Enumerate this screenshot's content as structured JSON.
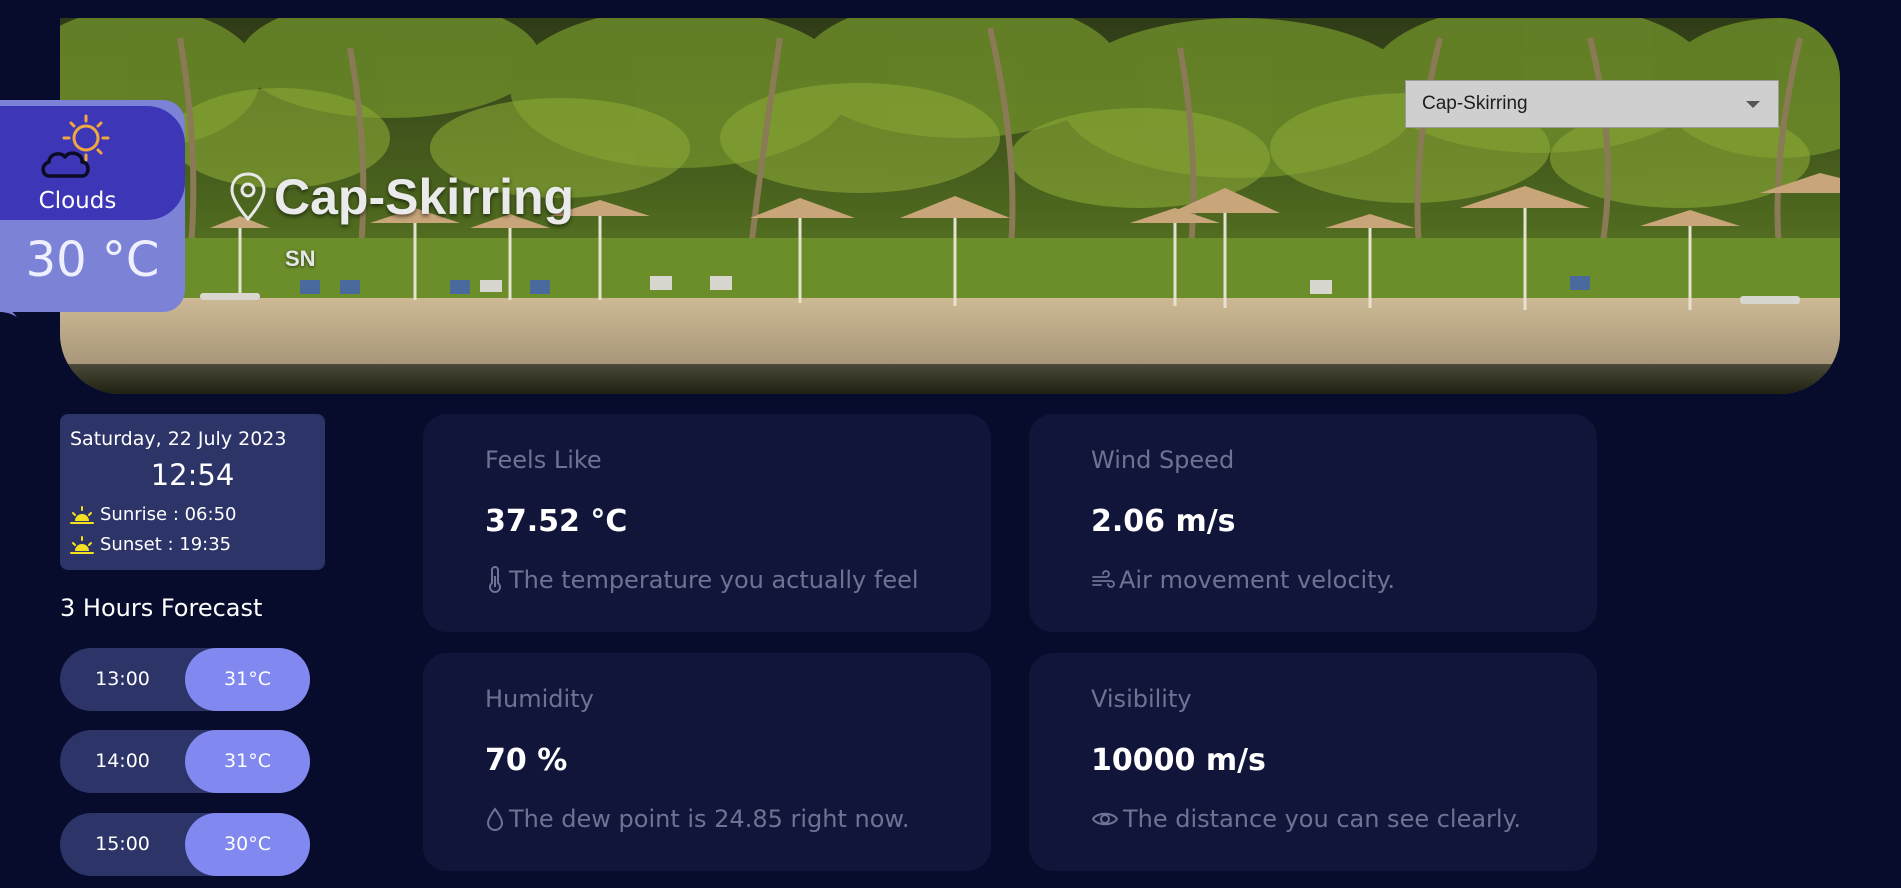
{
  "header": {
    "city_select": {
      "value": "Cap-Skirring",
      "options": [
        "Cap-Skirring"
      ]
    },
    "location": {
      "city": "Cap-Skirring",
      "country": "SN"
    }
  },
  "current": {
    "condition": "Clouds",
    "temperature": "30 °C",
    "icon": "sun-cloud-icon"
  },
  "datetime": {
    "date": "Saturday, 22 July 2023",
    "time": "12:54",
    "sunrise": "Sunrise : 06:50",
    "sunset": "Sunset : 19:35"
  },
  "forecast": {
    "title": "3 Hours Forecast",
    "items": [
      {
        "hour": "13:00",
        "temp": "31°C"
      },
      {
        "hour": "14:00",
        "temp": "31°C"
      },
      {
        "hour": "15:00",
        "temp": "30°C"
      }
    ]
  },
  "stats": {
    "feels_like": {
      "title": "Feels Like",
      "value": "37.52 °C",
      "desc": "The temperature you actually feel",
      "icon": "thermometer-icon"
    },
    "wind": {
      "title": "Wind Speed",
      "value": "2.06 m/s",
      "desc": "Air movement velocity.",
      "icon": "wind-icon"
    },
    "humidity": {
      "title": "Humidity",
      "value": "70 %",
      "desc": "The dew point is 24.85 right now.",
      "icon": "droplet-icon"
    },
    "visibility": {
      "title": "Visibility",
      "value": "10000 m/s",
      "desc": "The distance you can see clearly.",
      "icon": "eye-icon"
    }
  },
  "colors": {
    "background": "#080c2c",
    "card": "#111539",
    "accent": "#8189f0",
    "badge_top": "#3d37b8",
    "badge_bottom": "#7c83d6"
  }
}
